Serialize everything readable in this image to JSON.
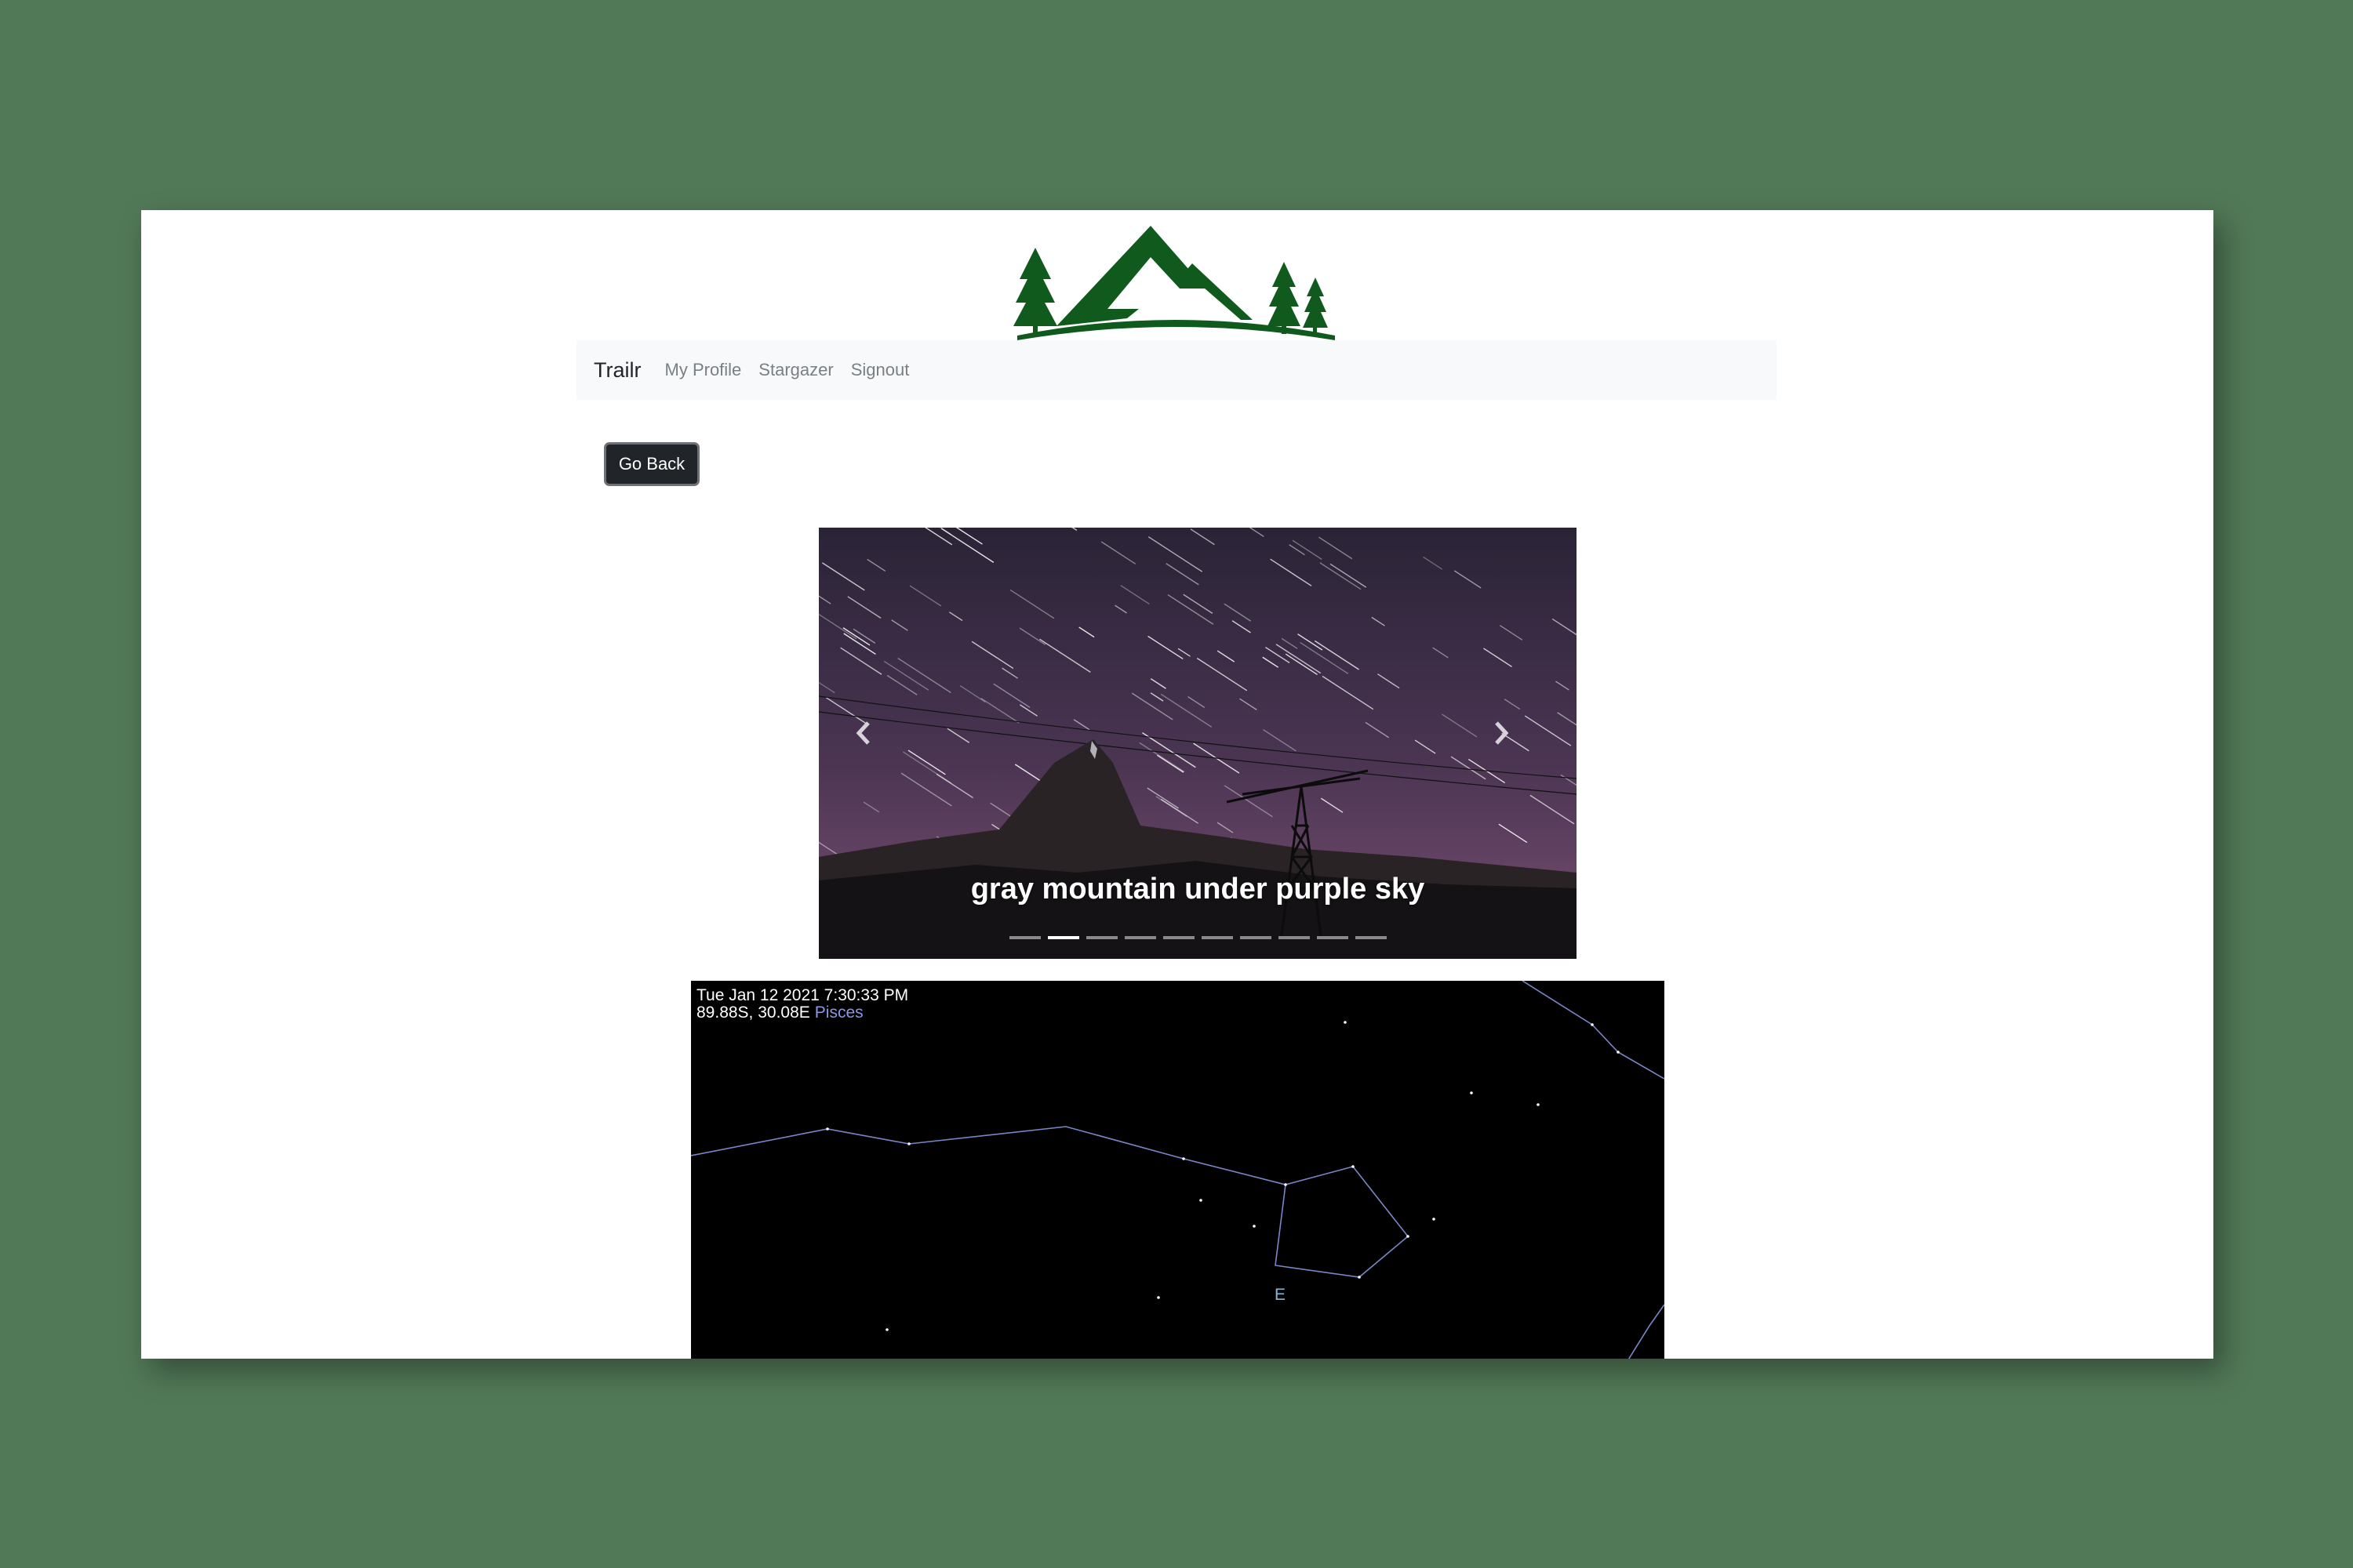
{
  "navbar": {
    "brand": "Trailr",
    "links": [
      "My Profile",
      "Stargazer",
      "Signout"
    ]
  },
  "actions": {
    "go_back": "Go Back"
  },
  "carousel": {
    "caption": "gray mountain under purple sky",
    "slide_count": 10,
    "active_index": 1
  },
  "skymap": {
    "datetime": "Tue Jan 12 2021 7:30:33 PM",
    "coordinates": "89.88S, 30.08E",
    "constellation": "Pisces",
    "compass": "E"
  },
  "colors": {
    "background": "#517857",
    "logo_green": "#0f5a1c",
    "constellation_line": "#7a86c8",
    "constellation_label": "#8c96e6"
  },
  "icons": [
    "mountain-logo-icon",
    "chevron-left-icon",
    "chevron-right-icon"
  ]
}
